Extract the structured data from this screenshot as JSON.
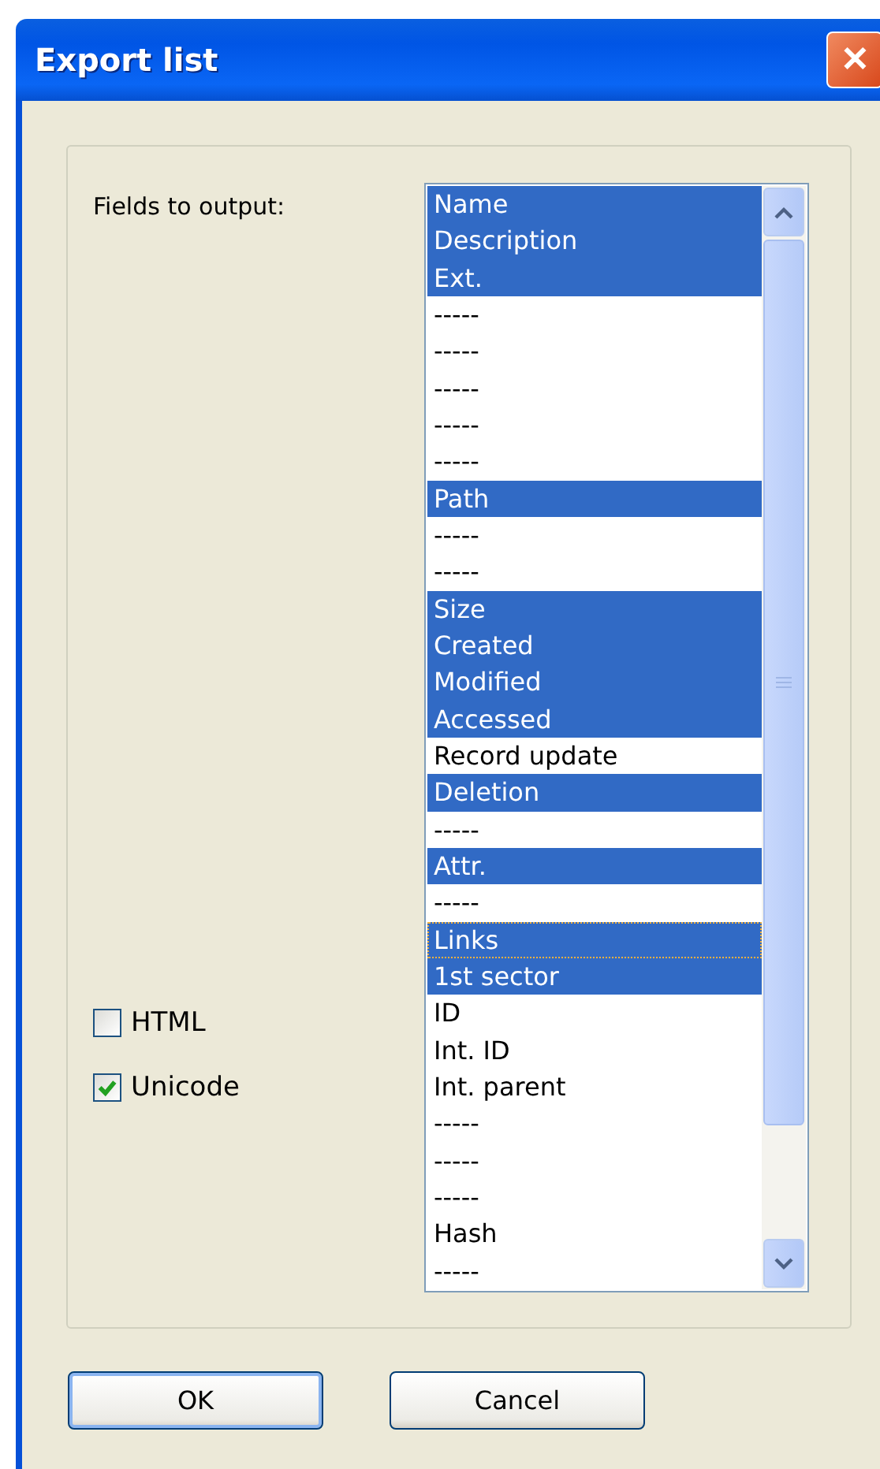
{
  "window": {
    "title": "Export list",
    "close": "✕"
  },
  "fields_label": "Fields to output:",
  "options": [
    {
      "label": "HTML",
      "checked": false
    },
    {
      "label": "Unicode",
      "checked": true
    }
  ],
  "fields": [
    {
      "label": "Name",
      "selected": true,
      "focused": false
    },
    {
      "label": "Description",
      "selected": true,
      "focused": false
    },
    {
      "label": "Ext.",
      "selected": true,
      "focused": false
    },
    {
      "label": "-----",
      "selected": false,
      "focused": false
    },
    {
      "label": "-----",
      "selected": false,
      "focused": false
    },
    {
      "label": "-----",
      "selected": false,
      "focused": false
    },
    {
      "label": "-----",
      "selected": false,
      "focused": false
    },
    {
      "label": "-----",
      "selected": false,
      "focused": false
    },
    {
      "label": "Path",
      "selected": true,
      "focused": false
    },
    {
      "label": "-----",
      "selected": false,
      "focused": false
    },
    {
      "label": "-----",
      "selected": false,
      "focused": false
    },
    {
      "label": "Size",
      "selected": true,
      "focused": false
    },
    {
      "label": "Created",
      "selected": true,
      "focused": false
    },
    {
      "label": "Modified",
      "selected": true,
      "focused": false
    },
    {
      "label": "Accessed",
      "selected": true,
      "focused": false
    },
    {
      "label": "Record update",
      "selected": false,
      "focused": false
    },
    {
      "label": "Deletion",
      "selected": true,
      "focused": false
    },
    {
      "label": "-----",
      "selected": false,
      "focused": false
    },
    {
      "label": "Attr.",
      "selected": true,
      "focused": false
    },
    {
      "label": "-----",
      "selected": false,
      "focused": false
    },
    {
      "label": "Links",
      "selected": true,
      "focused": true
    },
    {
      "label": "1st sector",
      "selected": true,
      "focused": false
    },
    {
      "label": "ID",
      "selected": false,
      "focused": false
    },
    {
      "label": "Int. ID",
      "selected": false,
      "focused": false
    },
    {
      "label": "Int. parent",
      "selected": false,
      "focused": false
    },
    {
      "label": "-----",
      "selected": false,
      "focused": false
    },
    {
      "label": "-----",
      "selected": false,
      "focused": false
    },
    {
      "label": "-----",
      "selected": false,
      "focused": false
    },
    {
      "label": "Hash",
      "selected": false,
      "focused": false
    },
    {
      "label": "-----",
      "selected": false,
      "focused": false
    }
  ],
  "buttons": [
    {
      "label": "OK",
      "default": true
    },
    {
      "label": "Cancel",
      "default": false
    }
  ]
}
